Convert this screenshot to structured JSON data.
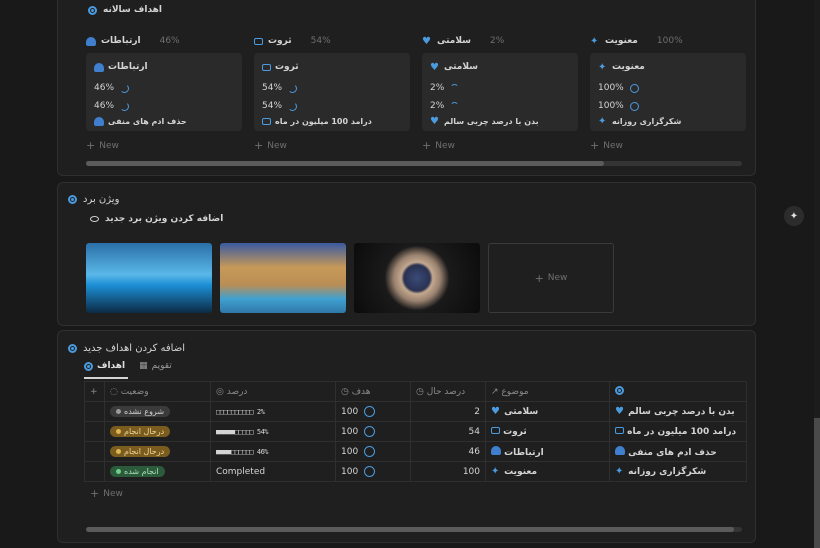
{
  "annual_goals": {
    "title": "اهداف سالانه",
    "columns": [
      {
        "name": "ارتباطات",
        "pct": "46%",
        "icon": "people-icon",
        "card_title": "ارتباطات",
        "v1": "46%",
        "v2": "46%",
        "footer": "حذف ادم های منفی",
        "footer_icon": "people-icon"
      },
      {
        "name": "ثروت",
        "pct": "54%",
        "icon": "money-icon",
        "card_title": "ثروت",
        "v1": "54%",
        "v2": "54%",
        "footer": "درامد 100 میلیون در ماه",
        "footer_icon": "money-icon"
      },
      {
        "name": "سلامتی",
        "pct": "2%",
        "icon": "heart-icon",
        "card_title": "سلامتی",
        "v1": "2%",
        "v2": "2%",
        "footer": "بدن با درصد چربی سالم",
        "footer_icon": "heart-icon"
      },
      {
        "name": "معنویت",
        "pct": "100%",
        "icon": "sparkle-icon",
        "card_title": "معنویت",
        "v1": "100%",
        "v2": "100%",
        "footer": "شکرگزاری روزانه",
        "footer_icon": "sparkle-icon"
      }
    ],
    "new_label": "New"
  },
  "vision": {
    "title": "ویژن برد",
    "add_label": "اضافه کردن ویژن برد جدید",
    "new_label": "New"
  },
  "new_goals": {
    "title": "اضافه کردن اهداف جدید",
    "tabs": [
      {
        "label": "اهداف"
      },
      {
        "label": "تقویم"
      }
    ],
    "headers": {
      "status": "وضعیت",
      "percent": "درصد",
      "target": "هدف",
      "current": "درصد حال",
      "topic": "موضوع"
    },
    "rows": [
      {
        "status": "شروع نشده",
        "status_color": "gray",
        "bar": "□□□□□□□□□□ 2%",
        "target": "100",
        "current": "2",
        "topic": "سلامتی",
        "name": "بدن با درصد چربی سالم"
      },
      {
        "status": "درحال انجام",
        "status_color": "yellow",
        "bar": "■■■■■□□□□□ 54%",
        "target": "100",
        "current": "54",
        "topic": "ثروت",
        "name": "درامد 100 میلیون در ماه"
      },
      {
        "status": "درحال انجام",
        "status_color": "yellow",
        "bar": "■■■■□□□□□□ 46%",
        "target": "100",
        "current": "46",
        "topic": "ارتباطات",
        "name": "حذف ادم های منفی"
      },
      {
        "status": "انجام شده",
        "status_color": "green",
        "bar": "Completed",
        "target": "100",
        "current": "100",
        "topic": "معنویت",
        "name": "شکرگزاری روزانه"
      }
    ],
    "new_label": "New"
  }
}
